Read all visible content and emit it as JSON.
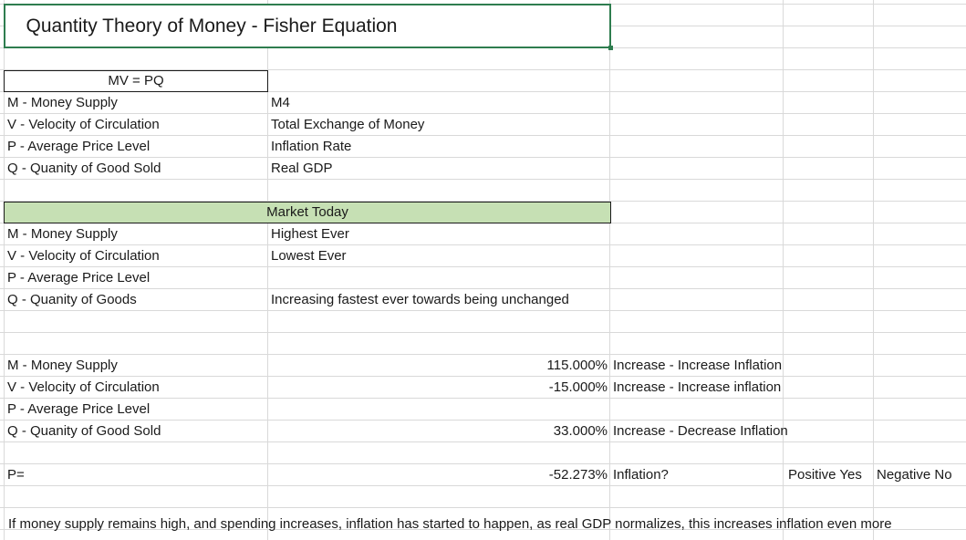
{
  "title": "Quantity Theory of Money - Fisher Equation",
  "definitions": {
    "equation": "MV = PQ",
    "rows": [
      {
        "term": "M - Money Supply",
        "meaning": "M4"
      },
      {
        "term": "V - Velocity of Circulation",
        "meaning": "Total Exchange of Money"
      },
      {
        "term": "P - Average Price Level",
        "meaning": "Inflation Rate"
      },
      {
        "term": "Q - Quanity of Good Sold",
        "meaning": "Real GDP"
      }
    ]
  },
  "market_today": {
    "header": "Market Today",
    "rows": [
      {
        "term": "M - Money Supply",
        "value": "Highest Ever"
      },
      {
        "term": "V - Velocity of Circulation",
        "value": "Lowest Ever"
      },
      {
        "term": "P - Average Price Level",
        "value": ""
      },
      {
        "term": "Q - Quanity of Goods",
        "value": "Increasing fastest ever towards being unchanged"
      }
    ]
  },
  "calculation": {
    "rows": [
      {
        "term": "M - Money Supply",
        "value": "115.000%",
        "effect": "Increase - Increase Inflation"
      },
      {
        "term": "V - Velocity of Circulation",
        "value": "-15.000%",
        "effect": "Increase - Increase inflation"
      },
      {
        "term": "P - Average Price Level",
        "value": "",
        "effect": ""
      },
      {
        "term": "Q - Quanity of Good Sold",
        "value": "33.000%",
        "effect": "Increase - Decrease Inflation"
      }
    ],
    "result": {
      "label": "P=",
      "value": "-52.273%",
      "question": "Inflation?",
      "positive": "Positive Yes",
      "negative": "Negative No"
    }
  },
  "footer_note": "If money supply remains high, and spending increases, inflation has started to happen, as real GDP normalizes, this increases inflation even more"
}
